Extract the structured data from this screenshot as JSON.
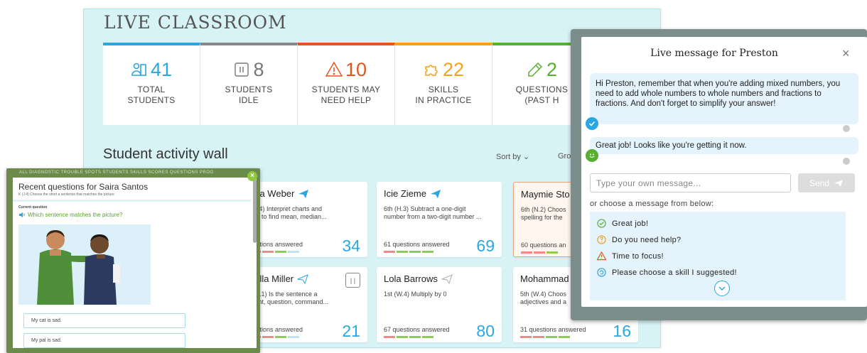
{
  "main": {
    "title": "LIVE CLASSROOM",
    "stats": [
      {
        "number": "41",
        "label_line1": "TOTAL",
        "label_line2": "STUDENTS",
        "icon": "students-icon",
        "color": "#2aa6e0"
      },
      {
        "number": "8",
        "label_line1": "STUDENTS",
        "label_line2": "IDLE",
        "icon": "pause-icon",
        "color": "#777777"
      },
      {
        "number": "10",
        "label_line1": "STUDENTS MAY",
        "label_line2": "NEED HELP",
        "icon": "warning-icon",
        "color": "#e2561e"
      },
      {
        "number": "22",
        "label_line1": "SKILLS",
        "label_line2": "IN PRACTICE",
        "icon": "puzzle-icon",
        "color": "#f2a31b"
      },
      {
        "number": "2",
        "label_line1": "QUESTIONS",
        "label_line2": "(PAST H",
        "icon": "pencil-icon",
        "color": "#58b030"
      }
    ],
    "wall_title": "Student activity wall",
    "sort_by": "Sort by ⌄",
    "group_by": "Gro",
    "cards": [
      {
        "name": "ana Weber",
        "skill": "(W.4) Interpret charts and\nphs  to find mean, median...",
        "answered": "uestions answered",
        "count": "34"
      },
      {
        "name": "Icie Zieme",
        "skill": "6th (H.3) Subtract a one-digit\nnumber from a two-digit number ...",
        "answered": "61 questions answered",
        "count": "69"
      },
      {
        "name": "Maymie Sto",
        "skill": "6th (N.2) Choos\nspelling for the",
        "answered": "60 questions an",
        "count": ""
      },
      {
        "name": "bella Miller",
        "skill": "OO.1) Is the sentence a\nment, question, command...",
        "answered": "uestions answered",
        "count": "21"
      },
      {
        "name": "Lola Barrows",
        "skill": "1st (W.4) Multiply by 0",
        "answered": "67 questions answered",
        "count": "80"
      },
      {
        "name": "Mohammad",
        "skill": "5th (W.4) Choos\nadjectives and a",
        "answered": "31 questions answered",
        "count": "16"
      }
    ]
  },
  "left_popup": {
    "nav": "ALL   DIAGNOSTIC   TROUBLE SPOTS   STUDENTS   SKILLS   SCORES   QUESTIONS   PROG",
    "title": "Recent questions for Saira Santos",
    "subtitle": "K (J.4)  Choose the short a sentence that matches the picture",
    "current_question_label": "Current question",
    "question": "Which sentence matches the picture?",
    "answers": [
      "My cat is sad.",
      "My pal is sad."
    ]
  },
  "right_popup": {
    "title": "Live message for Preston",
    "close": "×",
    "messages": [
      "Hi Preston, remember that when you're adding mixed numbers, you need to add whole numbers to whole numbers and fractions to fractions. And don't forget to simplify your answer!",
      "Great job! Looks like you're getting it now."
    ],
    "input_placeholder": "Type your own message...",
    "send_label": "Send",
    "choose_label": "or choose a message from below:",
    "options": [
      {
        "label": "Great job!",
        "icon": "check-circle-icon",
        "color": "#58b030"
      },
      {
        "label": "Do you need help?",
        "icon": "question-circle-icon",
        "color": "#f2a31b"
      },
      {
        "label": "Time to focus!",
        "icon": "warning-icon",
        "color": "#e2561e"
      },
      {
        "label": "Please choose a skill I suggested!",
        "icon": "refresh-circle-icon",
        "color": "#2aa6e0"
      }
    ]
  }
}
